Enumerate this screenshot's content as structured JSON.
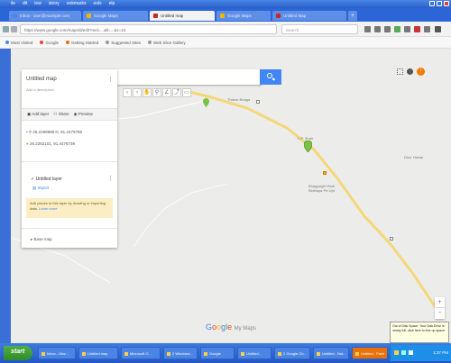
{
  "window": {
    "menu": [
      "ile",
      "dit",
      "iew",
      "istory",
      "ookmarks",
      "ools",
      "elp"
    ]
  },
  "tabs": [
    {
      "label": "Inbox - user@example.com"
    },
    {
      "label": "Google Maps"
    },
    {
      "label": "Untitled map"
    },
    {
      "label": "Google Maps"
    },
    {
      "label": "Untitled Map"
    }
  ],
  "address": {
    "url": "https://www.google.com/maps/d/edit?mid=...&ll=...&z=15",
    "search_placeholder": "Search"
  },
  "bookmarks": [
    {
      "label": "Most Visited"
    },
    {
      "label": "Google"
    },
    {
      "label": "Getting Started"
    },
    {
      "label": "Suggested Sites"
    },
    {
      "label": "Web Slice Gallery"
    }
  ],
  "panel": {
    "title": "Untitled map",
    "description": "Add a description",
    "actions": [
      "Add layer",
      "Share",
      "Preview"
    ],
    "coord_row_1": "26.2289889 N, 91.4479789",
    "coord_row_2": "26.2262101, 91.4476739",
    "layer_title": "Untitled layer",
    "layer_sub": "Import",
    "notice_text": "Add places to this layer by drawing or importing data.",
    "notice_link": "Learn more",
    "basemap": "Base map"
  },
  "map": {
    "labels": {
      "thakur": "Thakur Bhaga",
      "stadium": "Bhagyagiri Hindi\nBidelaya Prt Upt",
      "dhur": "Dhur Hawar",
      "km": "L.P. Shah"
    },
    "google_logo": [
      "G",
      "o",
      "o",
      "g",
      "l",
      "e"
    ],
    "my_maps": "My Maps",
    "zoom_in": "+",
    "zoom_out": "−"
  },
  "notification": "Out of Disk Space: Your Disk Drive is nearly full, click here to free up space.",
  "taskbar": {
    "start": "start",
    "tasks": [
      "Inbox - Moz...",
      "Untitled map",
      "Microsoft O...",
      "2 Windows...",
      "Google",
      "Untitled...",
      "2 Google Ch...",
      "Untitled - Not...",
      "Untitled - Paint"
    ],
    "clock": "1:37 PM"
  },
  "colors": {
    "accent": "#4285f4",
    "road": "#f5d77a",
    "pin": "#7cc142"
  }
}
